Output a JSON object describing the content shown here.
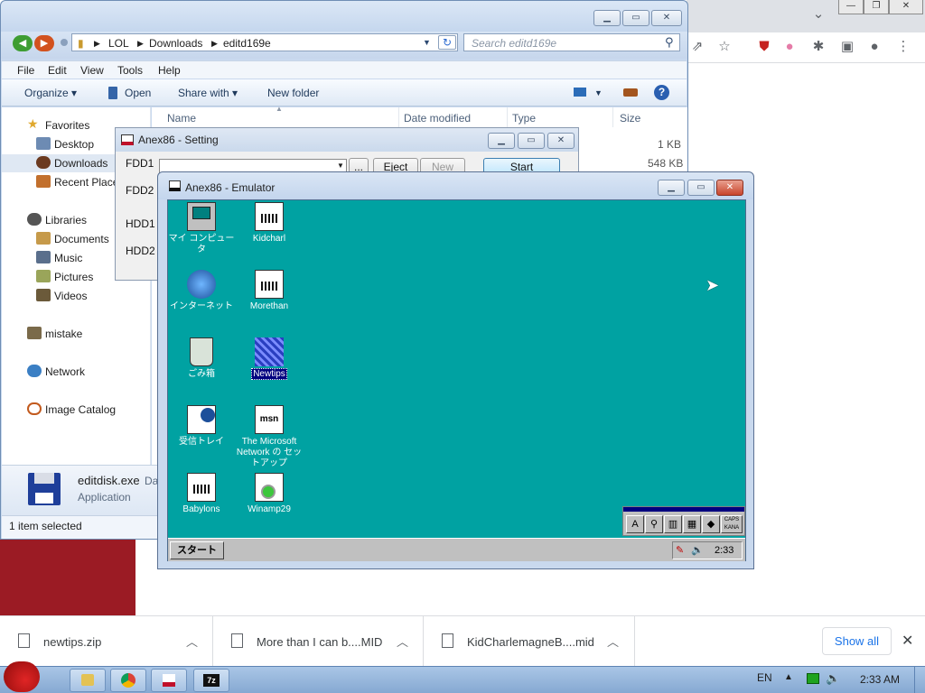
{
  "explorer": {
    "path": [
      "LOL",
      "Downloads",
      "editd169e"
    ],
    "search_placeholder": "Search editd169e",
    "menu": [
      "File",
      "Edit",
      "View",
      "Tools",
      "Help"
    ],
    "commands": {
      "organize": "Organize",
      "open": "Open",
      "share_with": "Share with",
      "new_folder": "New folder"
    },
    "sidebar": {
      "favorites": "Favorites",
      "favorites_items": [
        "Desktop",
        "Downloads",
        "Recent Place"
      ],
      "libraries": "Libraries",
      "libraries_items": [
        "Documents",
        "Music",
        "Pictures",
        "Videos"
      ],
      "mistake": "mistake",
      "network": "Network",
      "image_catalog": "Image Catalog"
    },
    "columns": [
      "Name",
      "Date modified",
      "Type",
      "Size"
    ],
    "sizes": [
      "1 KB",
      "548 KB"
    ],
    "details": {
      "name": "editdisk.exe",
      "date_label": "Dat",
      "type": "Application"
    },
    "status": "1 item selected"
  },
  "setting": {
    "title": "Anex86 - Setting",
    "labels": [
      "FDD1",
      "FDD2",
      "HDD1",
      "HDD2"
    ],
    "browse": "...",
    "eject": "Eject",
    "new": "New",
    "start": "Start"
  },
  "emulator": {
    "title": "Anex86 - Emulator",
    "icons": [
      "マイ コンピュータ",
      "Kidcharl",
      "インターネット",
      "Morethan",
      "ごみ箱",
      "Newtips",
      "受信トレイ",
      "The Microsoft Network の セットアップ",
      "Babylons",
      "Winamp29"
    ],
    "start": "スタート",
    "clock": "2:33",
    "ime_caps": "CAPS",
    "ime_kana": "KANA",
    "ime_a": "A"
  },
  "downloads": {
    "items": [
      "newtips.zip",
      "More than I can b....MID",
      "KidCharlemagneB....mid"
    ],
    "show_all": "Show all"
  },
  "taskbar": {
    "lang": "EN",
    "time": "2:33 AM",
    "app_7z": "7z"
  }
}
